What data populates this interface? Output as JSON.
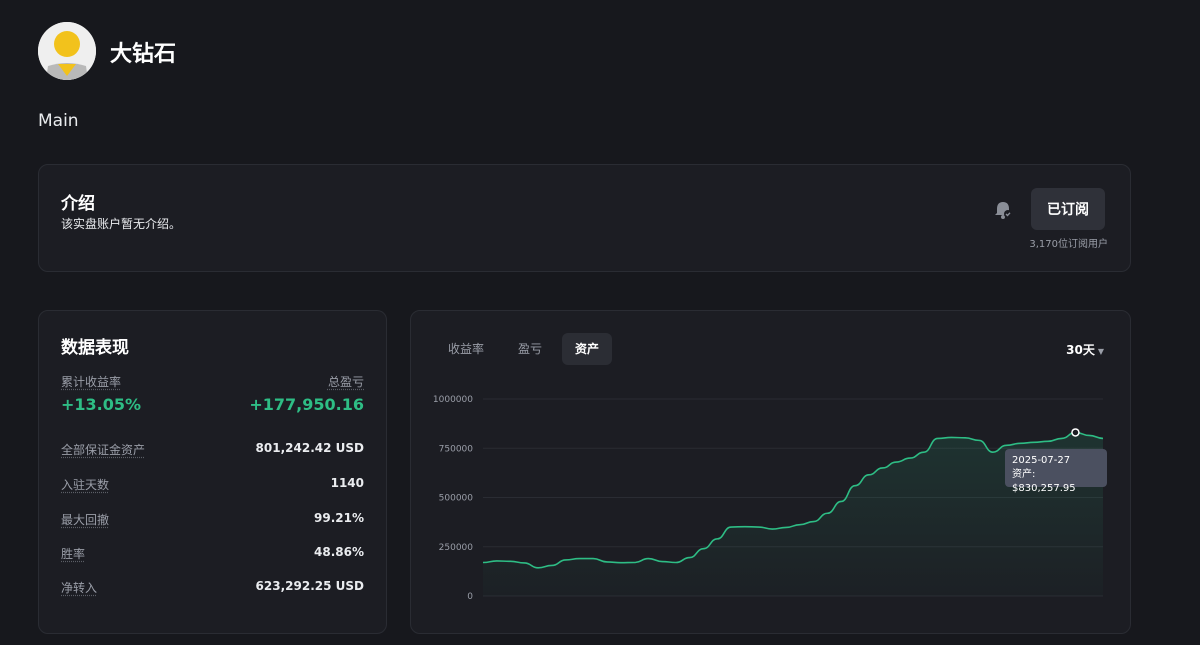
{
  "profile": {
    "name": "大钻石",
    "account": "Main"
  },
  "intro": {
    "title": "介绍",
    "text": "该实盘账户暂无介绍。",
    "subscribe_label": "已订阅",
    "subscribers": "3,170位订阅用户"
  },
  "stats": {
    "title": "数据表现",
    "cumulative_return_label": "累计收益率",
    "cumulative_return_value": "+13.05%",
    "total_pnl_label": "总盈亏",
    "total_pnl_value": "+177,950.16",
    "rows": [
      {
        "label": "全部保证金资产",
        "value": "801,242.42 USD"
      },
      {
        "label": "入驻天数",
        "value": "1140"
      },
      {
        "label": "最大回撤",
        "value": "99.21%"
      },
      {
        "label": "胜率",
        "value": "48.86%"
      },
      {
        "label": "净转入",
        "value": "623,292.25 USD"
      }
    ]
  },
  "chart_panel": {
    "tabs": [
      {
        "label": "收益率"
      },
      {
        "label": "盈亏"
      },
      {
        "label": "资产"
      }
    ],
    "active_tab": 2,
    "range": "30天"
  },
  "tooltip": {
    "date": "2025-07-27",
    "text": "资产: $830,257.95"
  },
  "colors": {
    "accent_green": "#2ebd85",
    "background": "#17181d",
    "card": "#1c1d23"
  },
  "icons": {
    "subscribe": "bell-check-icon",
    "range": "caret-down-icon"
  },
  "chart_data": {
    "type": "area",
    "title": "",
    "xlabel": "",
    "ylabel": "",
    "ylim": [
      0,
      1000000
    ],
    "yticks": [
      0,
      250000,
      500000,
      750000,
      1000000
    ],
    "ytick_labels": [
      "0",
      "250000",
      "500000",
      "750000",
      "1000000"
    ],
    "grid": true,
    "series": [
      {
        "values": [
          170000,
          178000,
          176000,
          168000,
          143000,
          155000,
          183000,
          190000,
          190000,
          173000,
          169000,
          170000,
          190000,
          175000,
          170000,
          195000,
          240000,
          290000,
          350000,
          352000,
          350000,
          340000,
          348000,
          362000,
          378000,
          420000,
          480000,
          560000,
          615000,
          650000,
          680000,
          700000,
          730000,
          800000,
          805000,
          803000,
          790000,
          730000,
          765000,
          775000,
          780000,
          785000,
          800000,
          830257.95,
          815000,
          800000
        ]
      }
    ],
    "highlight_index": 43
  }
}
